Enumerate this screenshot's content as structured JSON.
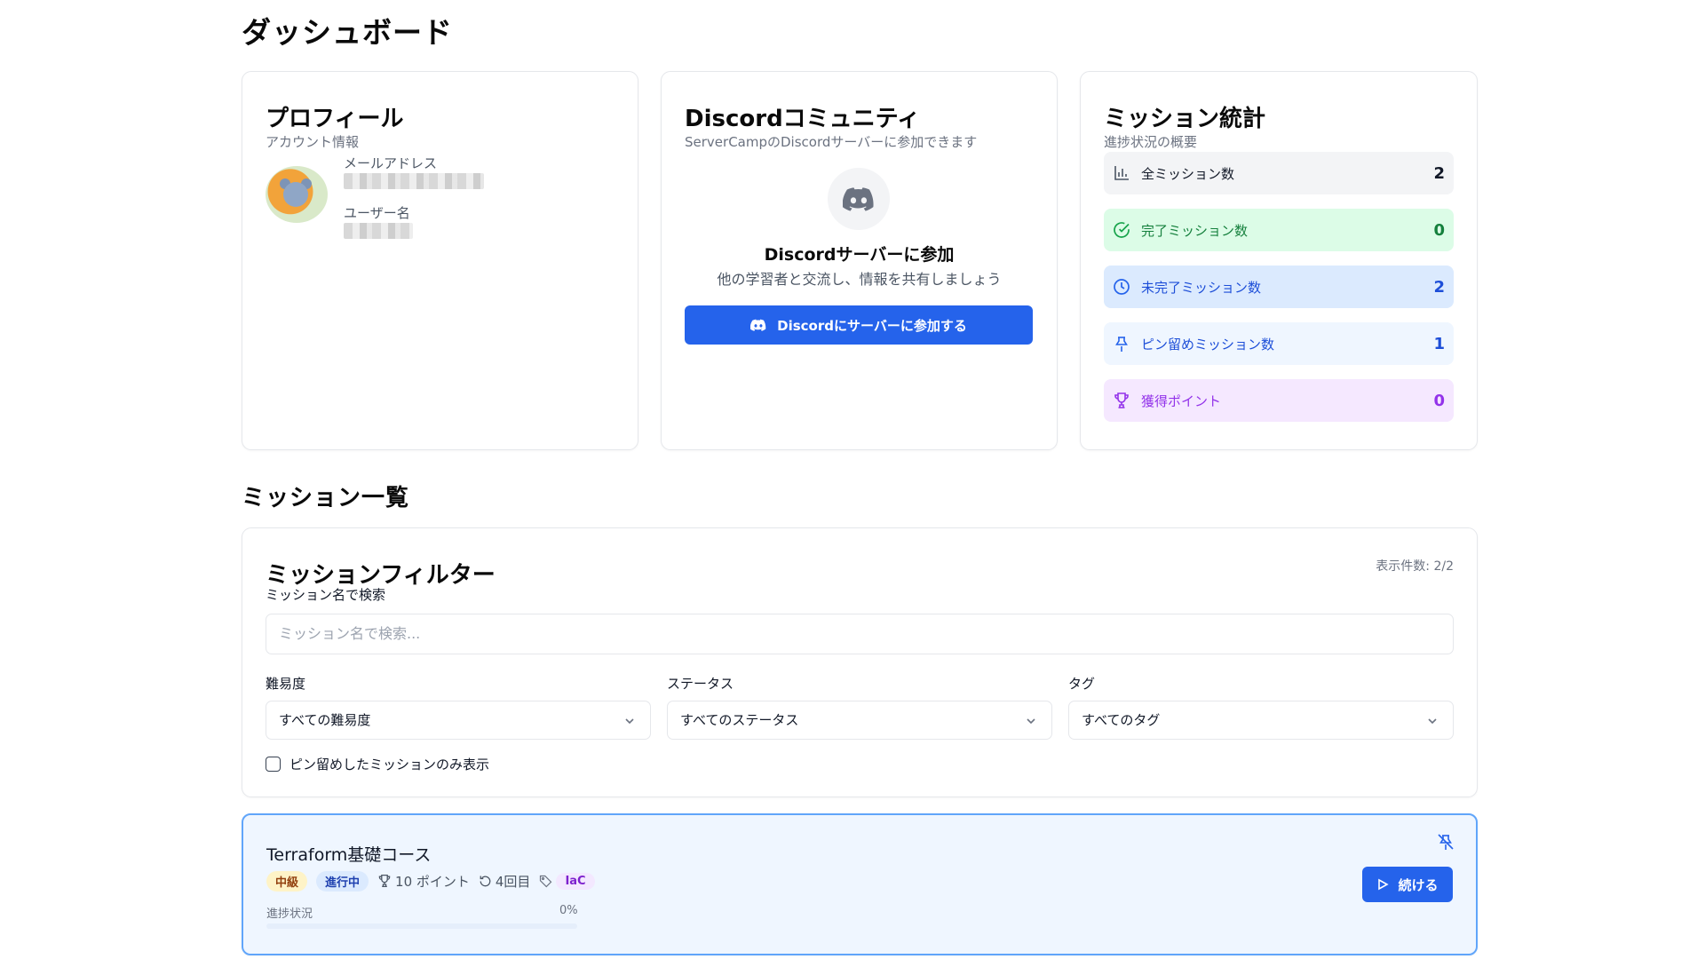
{
  "page": {
    "title": "ダッシュボード"
  },
  "profile": {
    "title": "プロフィール",
    "subtitle": "アカウント情報",
    "email_label": "メールアドレス",
    "username_label": "ユーザー名"
  },
  "discord": {
    "title": "Discordコミュニティ",
    "subtitle": "ServerCampのDiscordサーバーに参加できます",
    "heading": "Discordサーバーに参加",
    "description": "他の学習者と交流し、情報を共有しましょう",
    "button_label": "Discordにサーバーに参加する"
  },
  "stats": {
    "title": "ミッション統計",
    "subtitle": "進捗状況の概要",
    "items": [
      {
        "label": "全ミッション数",
        "value": "2",
        "icon": "bar-chart-icon",
        "color": "#111827",
        "bg": "#f3f4f6"
      },
      {
        "label": "完了ミッション数",
        "value": "0",
        "icon": "check-circle-icon",
        "color": "#15803d",
        "bg": "#dcfce7"
      },
      {
        "label": "未完了ミッション数",
        "value": "2",
        "icon": "clock-icon",
        "color": "#1d4ed8",
        "bg": "#dbeafe"
      },
      {
        "label": "ピン留めミッション数",
        "value": "1",
        "icon": "pin-icon",
        "color": "#1d4ed8",
        "bg": "#eff6ff"
      },
      {
        "label": "獲得ポイント",
        "value": "0",
        "icon": "trophy-icon",
        "color": "#9333ea",
        "bg": "#f5e8ff"
      }
    ]
  },
  "missions": {
    "section_title": "ミッション一覧",
    "filter": {
      "title": "ミッションフィルター",
      "count": "表示件数: 2/2",
      "search_label": "ミッション名で検索",
      "search_placeholder": "ミッション名で検索...",
      "difficulty_label": "難易度",
      "difficulty_value": "すべての難易度",
      "status_label": "ステータス",
      "status_value": "すべてのステータス",
      "tag_label": "タグ",
      "tag_value": "すべてのタグ",
      "pinned_only_label": "ピン留めしたミッションのみ表示",
      "pinned_only_checked": false
    },
    "list": [
      {
        "title": "Terraform基礎コース",
        "level": "中級",
        "status": "進行中",
        "points": "10 ポイント",
        "attempt": "4回目",
        "tag": "IaC",
        "progress_label": "進捗状況",
        "progress_text": "0%",
        "progress": 0,
        "continue_label": "続ける"
      }
    ]
  }
}
